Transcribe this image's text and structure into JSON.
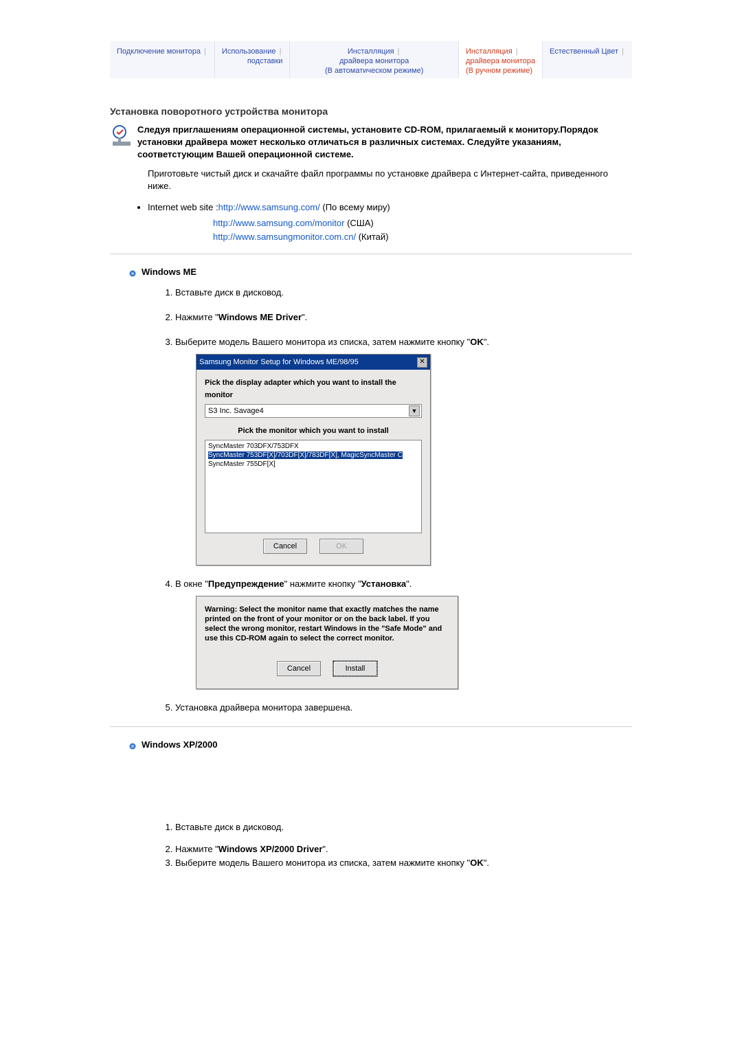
{
  "nav": {
    "tab1": "Подключение монитора",
    "tab2_l1": "Использование",
    "tab2_l2": "подставки",
    "tab3_l1": "Инсталляция",
    "tab3_l2": "драйвера монитора",
    "tab3_l3": "(В автоматическом режиме)",
    "tab4_l1": "Инсталляция",
    "tab4_l2": "драйвера монитора",
    "tab4_l3": "(В ручном режиме)",
    "tab5": "Естественный Цвет"
  },
  "heading": "Установка поворотного устройства монитора",
  "note": "Следуя приглашениям операционной системы, установите CD-ROM, прилагаемый к монитору.Порядок установки драйвера может несколько отличаться в различных системах. Следуйте указаниям, соответстующим Вашей операционной системе.",
  "prep_text": "Приготовьте чистый диск и скачайте файл программы по установке драйвера с Интернет-сайта, приведенного ниже.",
  "links_label": "Internet web site :",
  "link1": "http://www.samsung.com/",
  "link1_sfx": " (По всему миру)",
  "link2": "http://www.samsung.com/monitor",
  "link2_sfx": " (США)",
  "link3": "http://www.samsungmonitor.com.cn/",
  "link3_sfx": " (Китай)",
  "me": {
    "title": "Windows ME",
    "s1": "Вставьте диск в дисковод.",
    "s2_a": "Нажмите \"",
    "s2_b": "Windows ME Driver",
    "s2_c": "\".",
    "s3_a": "Выберите модель Вашего монитора из списка, затем нажмите кнопку \"",
    "s3_b": "OK",
    "s3_c": "\".",
    "s4_a": "В окне \"",
    "s4_b": "Предупреждение",
    "s4_c": "\" нажмите кнопку \"",
    "s4_d": "Установка",
    "s4_e": "\".",
    "s5": "Установка драйвера монитора завершена."
  },
  "dlg1": {
    "title": "Samsung Monitor Setup for Windows  ME/98/95",
    "close": "✕",
    "lbl1": "Pick the display adapter which you want to install the monitor",
    "adapter": "S3 Inc. Savage4",
    "lbl2": "Pick the monitor which you want to install",
    "row1": "SyncMaster 703DFX/753DFX",
    "row2": "SyncMaster 753DF[X]/703DF[X]/783DF[X], MagicSyncMaster C",
    "row3": "SyncMaster 755DF[X]",
    "cancel": "Cancel",
    "ok": "OK"
  },
  "dlg2": {
    "text": "Warning: Select the monitor name that exactly matches the name printed on the front of your monitor or on the back label. If you select the wrong monitor, restart Windows in the \"Safe Mode\" and use this CD-ROM again to select the correct monitor.",
    "cancel": "Cancel",
    "install": "Install"
  },
  "xp": {
    "title": "Windows XP/2000",
    "s1": "Вставьте диск в дисковод.",
    "s2_a": "Нажмите \"",
    "s2_b": "Windows XP/2000 Driver",
    "s2_c": "\".",
    "s3_a": "Выберите модель Вашего монитора из списка, затем нажмите кнопку \"",
    "s3_b": "OK",
    "s3_c": "\"."
  }
}
